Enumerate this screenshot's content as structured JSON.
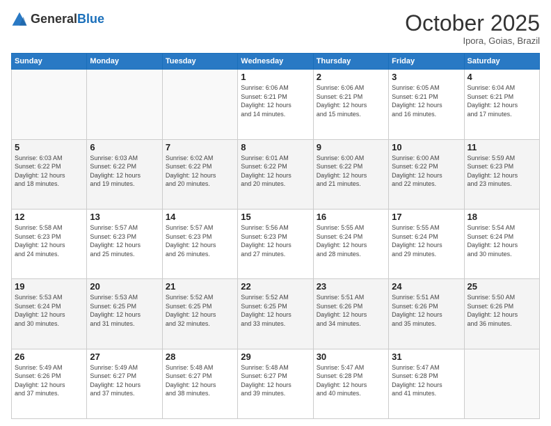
{
  "header": {
    "logo_general": "General",
    "logo_blue": "Blue",
    "month": "October 2025",
    "location": "Ipora, Goias, Brazil"
  },
  "weekdays": [
    "Sunday",
    "Monday",
    "Tuesday",
    "Wednesday",
    "Thursday",
    "Friday",
    "Saturday"
  ],
  "weeks": [
    [
      {
        "day": "",
        "info": ""
      },
      {
        "day": "",
        "info": ""
      },
      {
        "day": "",
        "info": ""
      },
      {
        "day": "1",
        "info": "Sunrise: 6:06 AM\nSunset: 6:21 PM\nDaylight: 12 hours\nand 14 minutes."
      },
      {
        "day": "2",
        "info": "Sunrise: 6:06 AM\nSunset: 6:21 PM\nDaylight: 12 hours\nand 15 minutes."
      },
      {
        "day": "3",
        "info": "Sunrise: 6:05 AM\nSunset: 6:21 PM\nDaylight: 12 hours\nand 16 minutes."
      },
      {
        "day": "4",
        "info": "Sunrise: 6:04 AM\nSunset: 6:21 PM\nDaylight: 12 hours\nand 17 minutes."
      }
    ],
    [
      {
        "day": "5",
        "info": "Sunrise: 6:03 AM\nSunset: 6:22 PM\nDaylight: 12 hours\nand 18 minutes."
      },
      {
        "day": "6",
        "info": "Sunrise: 6:03 AM\nSunset: 6:22 PM\nDaylight: 12 hours\nand 19 minutes."
      },
      {
        "day": "7",
        "info": "Sunrise: 6:02 AM\nSunset: 6:22 PM\nDaylight: 12 hours\nand 20 minutes."
      },
      {
        "day": "8",
        "info": "Sunrise: 6:01 AM\nSunset: 6:22 PM\nDaylight: 12 hours\nand 20 minutes."
      },
      {
        "day": "9",
        "info": "Sunrise: 6:00 AM\nSunset: 6:22 PM\nDaylight: 12 hours\nand 21 minutes."
      },
      {
        "day": "10",
        "info": "Sunrise: 6:00 AM\nSunset: 6:22 PM\nDaylight: 12 hours\nand 22 minutes."
      },
      {
        "day": "11",
        "info": "Sunrise: 5:59 AM\nSunset: 6:23 PM\nDaylight: 12 hours\nand 23 minutes."
      }
    ],
    [
      {
        "day": "12",
        "info": "Sunrise: 5:58 AM\nSunset: 6:23 PM\nDaylight: 12 hours\nand 24 minutes."
      },
      {
        "day": "13",
        "info": "Sunrise: 5:57 AM\nSunset: 6:23 PM\nDaylight: 12 hours\nand 25 minutes."
      },
      {
        "day": "14",
        "info": "Sunrise: 5:57 AM\nSunset: 6:23 PM\nDaylight: 12 hours\nand 26 minutes."
      },
      {
        "day": "15",
        "info": "Sunrise: 5:56 AM\nSunset: 6:23 PM\nDaylight: 12 hours\nand 27 minutes."
      },
      {
        "day": "16",
        "info": "Sunrise: 5:55 AM\nSunset: 6:24 PM\nDaylight: 12 hours\nand 28 minutes."
      },
      {
        "day": "17",
        "info": "Sunrise: 5:55 AM\nSunset: 6:24 PM\nDaylight: 12 hours\nand 29 minutes."
      },
      {
        "day": "18",
        "info": "Sunrise: 5:54 AM\nSunset: 6:24 PM\nDaylight: 12 hours\nand 30 minutes."
      }
    ],
    [
      {
        "day": "19",
        "info": "Sunrise: 5:53 AM\nSunset: 6:24 PM\nDaylight: 12 hours\nand 30 minutes."
      },
      {
        "day": "20",
        "info": "Sunrise: 5:53 AM\nSunset: 6:25 PM\nDaylight: 12 hours\nand 31 minutes."
      },
      {
        "day": "21",
        "info": "Sunrise: 5:52 AM\nSunset: 6:25 PM\nDaylight: 12 hours\nand 32 minutes."
      },
      {
        "day": "22",
        "info": "Sunrise: 5:52 AM\nSunset: 6:25 PM\nDaylight: 12 hours\nand 33 minutes."
      },
      {
        "day": "23",
        "info": "Sunrise: 5:51 AM\nSunset: 6:26 PM\nDaylight: 12 hours\nand 34 minutes."
      },
      {
        "day": "24",
        "info": "Sunrise: 5:51 AM\nSunset: 6:26 PM\nDaylight: 12 hours\nand 35 minutes."
      },
      {
        "day": "25",
        "info": "Sunrise: 5:50 AM\nSunset: 6:26 PM\nDaylight: 12 hours\nand 36 minutes."
      }
    ],
    [
      {
        "day": "26",
        "info": "Sunrise: 5:49 AM\nSunset: 6:26 PM\nDaylight: 12 hours\nand 37 minutes."
      },
      {
        "day": "27",
        "info": "Sunrise: 5:49 AM\nSunset: 6:27 PM\nDaylight: 12 hours\nand 37 minutes."
      },
      {
        "day": "28",
        "info": "Sunrise: 5:48 AM\nSunset: 6:27 PM\nDaylight: 12 hours\nand 38 minutes."
      },
      {
        "day": "29",
        "info": "Sunrise: 5:48 AM\nSunset: 6:27 PM\nDaylight: 12 hours\nand 39 minutes."
      },
      {
        "day": "30",
        "info": "Sunrise: 5:47 AM\nSunset: 6:28 PM\nDaylight: 12 hours\nand 40 minutes."
      },
      {
        "day": "31",
        "info": "Sunrise: 5:47 AM\nSunset: 6:28 PM\nDaylight: 12 hours\nand 41 minutes."
      },
      {
        "day": "",
        "info": ""
      }
    ]
  ]
}
